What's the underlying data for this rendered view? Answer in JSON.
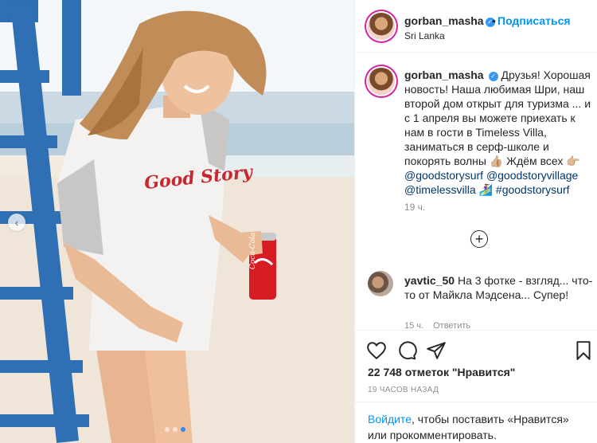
{
  "post": {
    "username": "gorban_masha",
    "verified_glyph": "✓",
    "separator": "•",
    "follow_label": "Подписаться",
    "location": "Sri Lanka"
  },
  "caption": {
    "username": "gorban_masha",
    "text": "Друзья! Хорошая новость! Наша любимая Шри, наш второй дом открыт для туризма ... и с 1 апреля вы можете приехать к нам в гости в Timeless Villa, заниматься в серф-школе и покорять волны 👍🏼 Ждём всех 👉🏼",
    "mentions": [
      "@goodstorysurf",
      "@goodstoryvillage",
      "@timelessvilla"
    ],
    "surf_emoji": "🏄‍♀️",
    "hashtag": "#goodstorysurf",
    "time": "19 ч."
  },
  "load_more_icon": "plus-circle-icon",
  "comment": {
    "username": "yavtic_50",
    "text": "На 3 фотке - взгляд... что-то от Майкла Мэдсена... Супер!",
    "time": "15 ч.",
    "reply_label": "Ответить"
  },
  "actions": {
    "like_icon": "heart-icon",
    "comment_icon": "comment-icon",
    "share_icon": "paper-plane-icon",
    "save_icon": "bookmark-icon"
  },
  "likes_text": "22 748 отметок \"Нравится\"",
  "timestamp": "19 ЧАСОВ НАЗАД",
  "login_prompt": {
    "link": "Войдите",
    "text": ", чтобы поставить «Нравится» или прокомментировать."
  },
  "photo": {
    "can_brand": "Coca-Cola",
    "shirt_text": "Good Story",
    "carousel_dots": 3,
    "carousel_active_index": 1,
    "prev_arrow": "‹"
  },
  "colors": {
    "accent": "#0095f6",
    "text": "#262626",
    "muted": "#8e8e8e",
    "verified": "#3897f0",
    "link": "#00376b"
  }
}
